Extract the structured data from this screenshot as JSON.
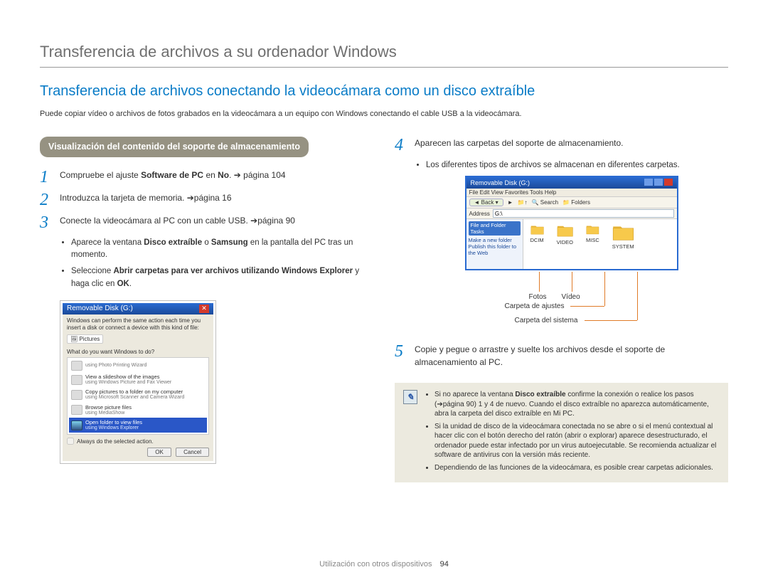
{
  "header": {
    "title": "Transferencia de archivos a su ordenador Windows"
  },
  "section": {
    "title": "Transferencia de archivos conectando la videocámara como un disco extraíble",
    "intro": "Puede copiar vídeo o archivos de fotos grabados en la videocámara a un equipo con Windows conectando el cable USB a la videocámara."
  },
  "badge": {
    "text": "Visualización del contenido del soporte de almacenamiento"
  },
  "steps": {
    "s1a": "Compruebe el ajuste ",
    "s1b": "Software de PC",
    "s1c": " en ",
    "s1d": "No",
    "s1e": ". ➔ página 104",
    "s2": "Introduzca la tarjeta de memoria. ➔página 16",
    "s3": "Conecte la videocámara al PC con un cable USB. ➔página 90",
    "s3b1a": "Aparece la ventana ",
    "s3b1b": "Disco extraíble",
    "s3b1c": " o ",
    "s3b1d": "Samsung",
    "s3b1e": " en la pantalla del PC tras un momento.",
    "s3b2a": "Seleccione ",
    "s3b2b": "Abrir carpetas para ver archivos utilizando Windows Explorer",
    "s3b2c": " y haga clic en ",
    "s3b2d": "OK",
    "s3b2e": ".",
    "s4": "Aparecen las carpetas del soporte de almacenamiento.",
    "s4b1": "Los diferentes tipos de archivos se almacenan en diferentes carpetas.",
    "s5": "Copie y pegue o arrastre y suelte los archivos desde el soporte de almacenamiento al PC."
  },
  "autoplay": {
    "title": "Removable Disk (G:)",
    "headline": "Windows can perform the same action each time you insert a disk or connect a device with this kind of file:",
    "pictures": "Pictures",
    "question": "What do you want Windows to do?",
    "items": [
      {
        "t": "using Photo Printing Wizard",
        "s": ""
      },
      {
        "t": "View a slideshow of the images",
        "s": "using Windows Picture and Fax Viewer"
      },
      {
        "t": "Copy pictures to a folder on my computer",
        "s": "using Microsoft Scanner and Camera Wizard"
      },
      {
        "t": "Browse picture files",
        "s": "using MediaShow"
      },
      {
        "t": "Open folder to view files",
        "s": "using Windows Explorer"
      }
    ],
    "always": "Always do the selected action.",
    "ok": "OK",
    "cancel": "Cancel"
  },
  "explorer": {
    "title": "Removable Disk (G:)",
    "menu": "File   Edit   View   Favorites   Tools   Help",
    "back": "Back ▾",
    "search": "Search",
    "foldersbtn": "Folders",
    "addrlabel": "Address",
    "addr": "G:\\",
    "sidehead": "File and Folder Tasks",
    "side1": "Make a new folder",
    "side2": "Publish this folder to the Web",
    "folders": [
      "DCIM",
      "VIDEO",
      "MISC",
      "SYSTEM"
    ]
  },
  "callouts": {
    "fotos": "Fotos",
    "video": "Vídeo",
    "ajustes": "Carpeta de ajustes",
    "sistema": "Carpeta del sistema"
  },
  "notes": {
    "n1a": "Si no aparece la ventana ",
    "n1b": "Disco extraíble",
    "n1c": " confirme la conexión o realice los pasos (➔página 90) 1 y 4 de nuevo. Cuando el disco extraíble no aparezca automáticamente, abra la carpeta del disco extraíble en Mi PC.",
    "n2": "Si la unidad de disco de la videocámara conectada no se abre o si el menú contextual al hacer clic con el botón derecho del ratón (abrir o explorar) aparece desestructurado, el ordenador puede estar infectado por un virus autoejecutable. Se recomienda actualizar el software de antivirus con la versión más reciente.",
    "n3": "Dependiendo de las funciones de la videocámara, es posible crear carpetas adicionales."
  },
  "footer": {
    "text": "Utilización con otros dispositivos",
    "page": "94"
  }
}
